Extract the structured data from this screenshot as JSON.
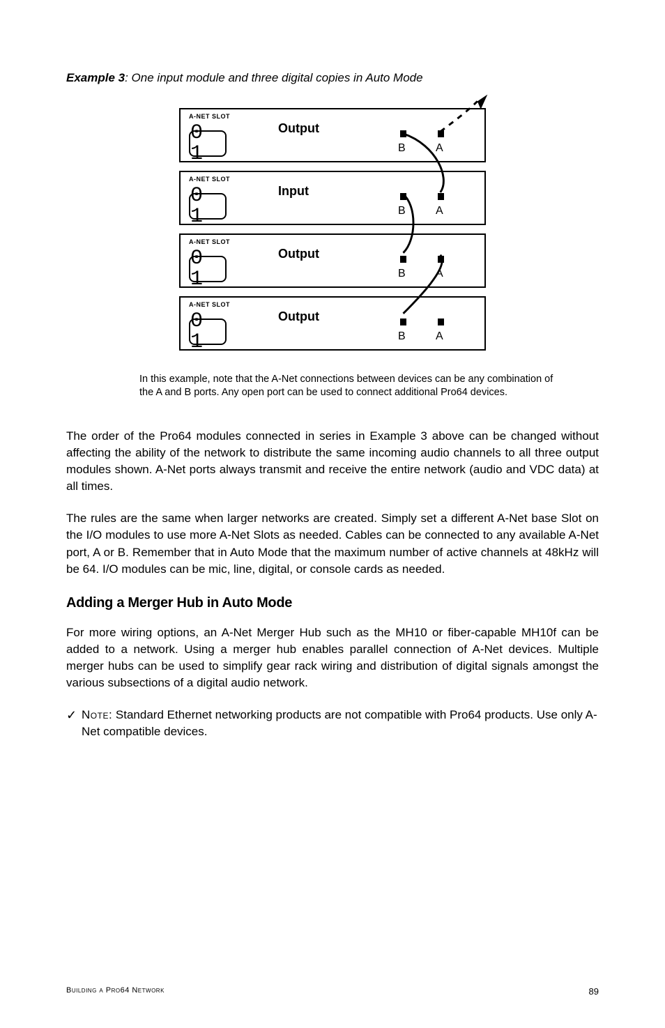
{
  "example": {
    "label": "Example 3",
    "subtitle": ":  One input module and three digital copies in Auto Mode"
  },
  "diagram": {
    "modules": [
      {
        "slot_label": "A-NET SLOT",
        "slot_value": "0 1",
        "io": "Output",
        "port_b": "B",
        "port_a": "A"
      },
      {
        "slot_label": "A-NET SLOT",
        "slot_value": "0 1",
        "io": "Input",
        "port_b": "B",
        "port_a": "A"
      },
      {
        "slot_label": "A-NET SLOT",
        "slot_value": "0 1",
        "io": "Output",
        "port_b": "B",
        "port_a": "A"
      },
      {
        "slot_label": "A-NET SLOT",
        "slot_value": "0 1",
        "io": "Output",
        "port_b": "B",
        "port_a": "A"
      }
    ]
  },
  "caption": "In this example, note that the A-Net connections between devices can be any combination of the A and B ports. Any open port can be used to connect additional Pro64 devices.",
  "para1": "The order of the Pro64 modules connected in series in Example 3 above can be changed without affecting the ability of the network to distribute the same incoming audio channels to all three output modules shown. A-Net ports always transmit and receive the entire network (audio and VDC data) at all times.",
  "para2": "The rules are the same when larger networks are created. Simply set a different A-Net base Slot on the I/O modules to use more A-Net Slots as needed. Cables can be connected to any available A-Net port, A or B. Remember that in Auto Mode that the maximum number of active channels at 48kHz will be 64. I/O modules can be mic, line, digital, or console cards as needed.",
  "heading": "Adding a Merger Hub in Auto Mode",
  "para3": "For more wiring options, an A-Net Merger Hub such as the MH10 or fiber-capable MH10f can be added to a network. Using a merger hub enables parallel connection of A-Net devices. Multiple merger hubs can be used to simplify gear rack wiring and distribution of digital signals amongst the various subsections of a digital audio network.",
  "note": {
    "check": "✓",
    "label": "Note:",
    "text": "Standard Ethernet networking products are not compatible with Pro64 products. Use only A-Net compatible devices."
  },
  "footer": {
    "left": "Building a Pro64 Network",
    "page": "89"
  }
}
